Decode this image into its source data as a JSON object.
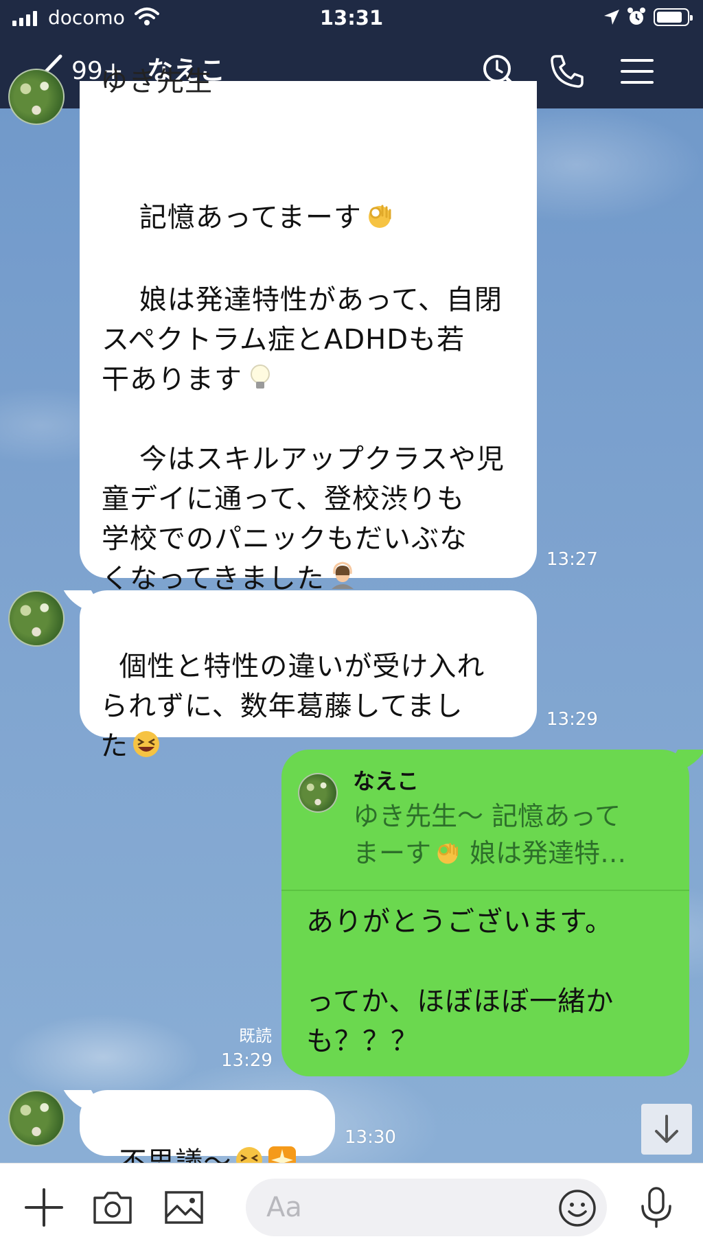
{
  "status_bar": {
    "carrier": "docomo",
    "time": "13:31"
  },
  "header": {
    "back_count": "99+",
    "title": "なえこ"
  },
  "messages": [
    {
      "id": "m1",
      "sender": "なえこ",
      "partial_top": "ゆき先生",
      "p1": "記憶あってまーす",
      "p2": "娘は発達特性があって、自閉\nスペクトラム症とADHDも若\n干あります",
      "p3": "今はスキルアップクラスや児\n童デイに通って、登校渋りも\n学校でのパニックもだいぶな\nくなってきました",
      "time": "13:27"
    },
    {
      "id": "m2",
      "text": "個性と特性の違いが受け入れ\nられずに、数年葛藤してまし\nた",
      "time": "13:29"
    },
    {
      "id": "m3",
      "quote_name": "なえこ",
      "quote_text_a": "ゆき先生〜 記憶あって\nまーす",
      "quote_text_b": " 娘は発達特…",
      "text": "ありがとうございます。\n\nってか、ほぼほぼ一緒か\nも？？？",
      "read_label": "既読",
      "time": "13:29"
    },
    {
      "id": "m4",
      "text": "不思議〜",
      "time": "13:30"
    }
  ],
  "input": {
    "placeholder": "Aa"
  },
  "colors": {
    "header_bg": "#1f2a44",
    "sent_bubble": "#6bd84f",
    "received_bubble": "#ffffff",
    "chat_bg": "#7aa0cc"
  },
  "icons": [
    "back-chevron-icon",
    "search-icon",
    "phone-icon",
    "menu-icon",
    "plus-icon",
    "camera-icon",
    "image-icon",
    "smile-icon",
    "microphone-icon",
    "arrow-down-icon"
  ]
}
